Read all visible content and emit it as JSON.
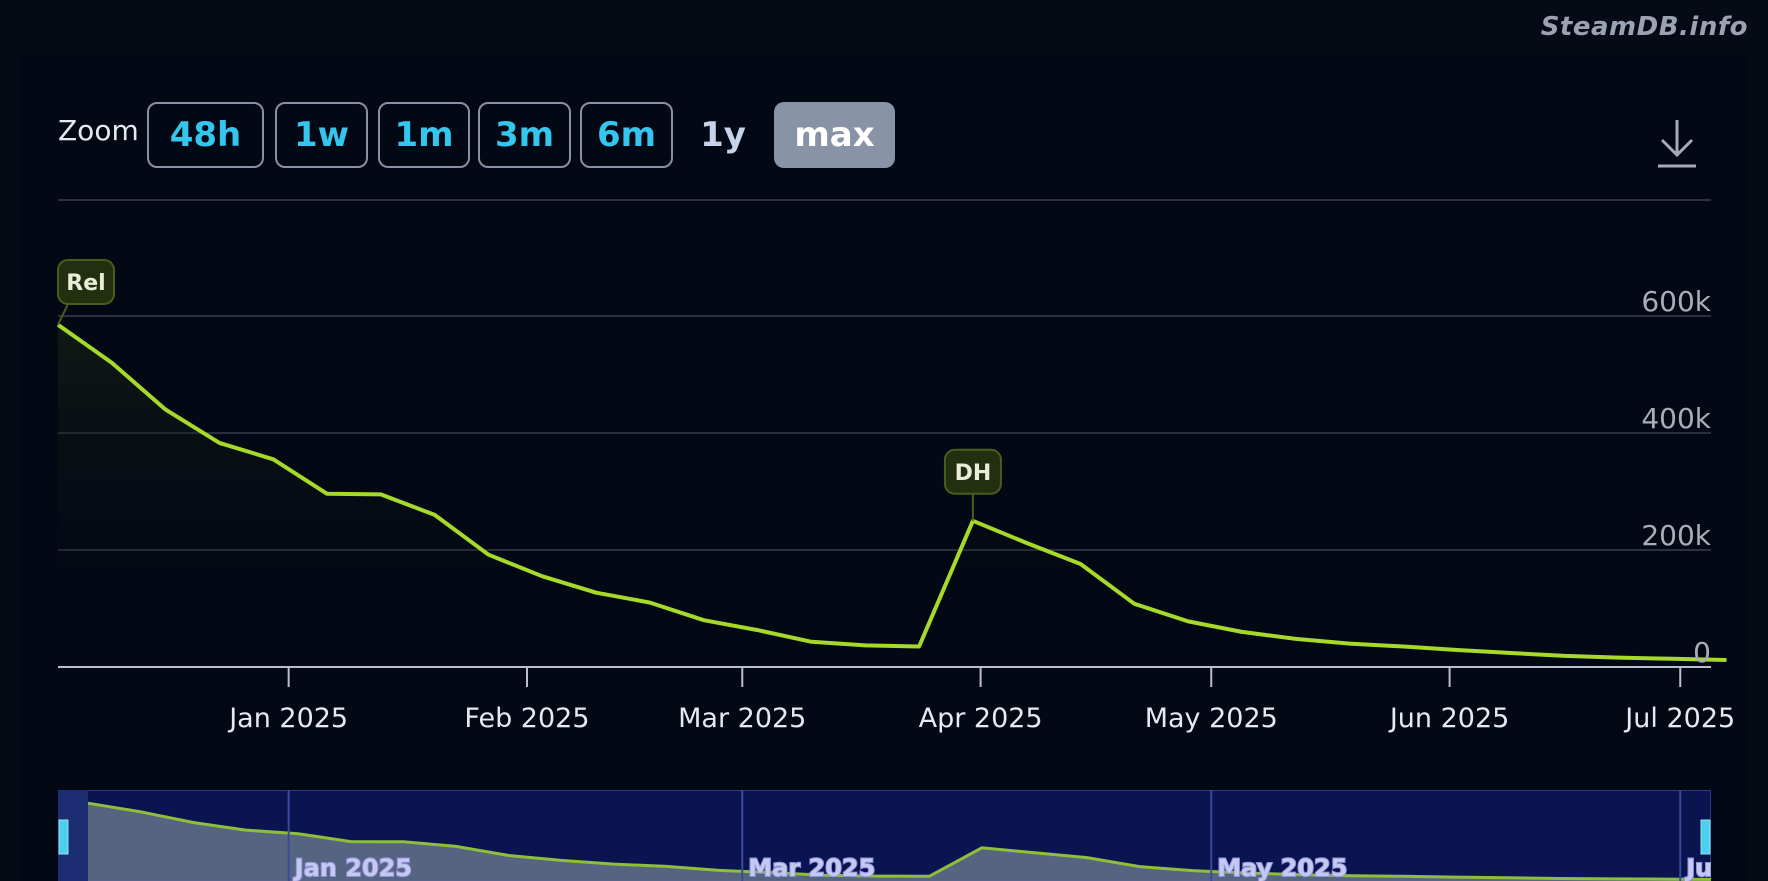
{
  "brand": "SteamDB.info",
  "zoom": {
    "label": "Zoom",
    "buttons": [
      "48h",
      "1w",
      "1m",
      "3m",
      "6m",
      "1y",
      "max"
    ],
    "active": "max"
  },
  "icons": {
    "download": "download-icon"
  },
  "colors": {
    "line": "#a6d92a",
    "flag_bg": "#23300f",
    "flag_border": "#4a5d1c",
    "navigator_bg": "#0a1450",
    "navigator_fill": "#5d6d86",
    "active_button": "#8993a7",
    "button_text": "#35c6ee"
  },
  "chart_data": {
    "type": "line",
    "y_ticks": [
      "0",
      "200k",
      "400k",
      "600k"
    ],
    "ylim": [
      0,
      600000
    ],
    "x_ticks": [
      "Jan 2025",
      "Feb 2025",
      "Mar 2025",
      "Apr 2025",
      "May 2025",
      "Jun 2025",
      "Jul 2025"
    ],
    "xlim": [
      "2024-12-02",
      "2025-07-05"
    ],
    "grid": true,
    "series": [
      {
        "points": [
          [
            "2024-12-02",
            585000
          ],
          [
            "2024-12-09",
            520000
          ],
          [
            "2024-12-16",
            440000
          ],
          [
            "2024-12-23",
            383000
          ],
          [
            "2024-12-30",
            355000
          ],
          [
            "2025-01-06",
            296000
          ],
          [
            "2025-01-13",
            295000
          ],
          [
            "2025-01-20",
            260000
          ],
          [
            "2025-01-27",
            192000
          ],
          [
            "2025-02-03",
            155000
          ],
          [
            "2025-02-10",
            127000
          ],
          [
            "2025-02-17",
            110000
          ],
          [
            "2025-02-24",
            80000
          ],
          [
            "2025-03-03",
            63000
          ],
          [
            "2025-03-10",
            43000
          ],
          [
            "2025-03-17",
            37000
          ],
          [
            "2025-03-24",
            35000
          ],
          [
            "2025-03-31",
            250000
          ],
          [
            "2025-04-07",
            212000
          ],
          [
            "2025-04-14",
            176000
          ],
          [
            "2025-04-21",
            108000
          ],
          [
            "2025-04-28",
            78000
          ],
          [
            "2025-05-05",
            60000
          ],
          [
            "2025-05-12",
            48000
          ],
          [
            "2025-05-19",
            40000
          ],
          [
            "2025-05-26",
            35000
          ],
          [
            "2025-06-02",
            29000
          ],
          [
            "2025-06-09",
            24000
          ],
          [
            "2025-06-16",
            19000
          ],
          [
            "2025-06-23",
            16000
          ],
          [
            "2025-06-30",
            14000
          ],
          [
            "2025-07-07",
            12000
          ]
        ]
      }
    ],
    "flags": [
      {
        "label": "Rel",
        "x": "2024-12-02"
      },
      {
        "label": "DH",
        "x": "2025-03-31"
      }
    ],
    "navigator": {
      "labels": [
        "Jan 2025",
        "Mar 2025",
        "May 2025",
        "Jul..."
      ]
    }
  }
}
